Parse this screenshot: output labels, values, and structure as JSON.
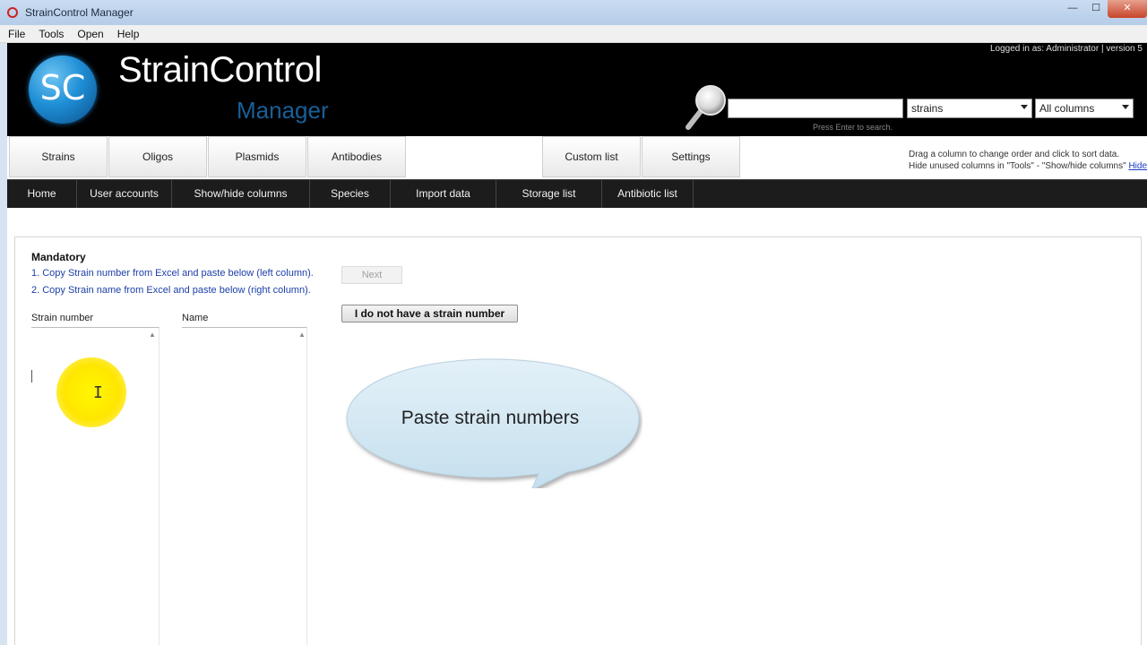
{
  "window": {
    "title": "StrainControl Manager",
    "minimize": "—",
    "maximize": "☐",
    "close": "✕"
  },
  "menu": [
    "File",
    "Tools",
    "Open",
    "Help"
  ],
  "header": {
    "logo_text": "SC",
    "app_name": "StrainControl",
    "app_subtitle": "Manager",
    "logged_in": "Logged in as: Administrator | version 5",
    "search_value": "",
    "search_hint": "Press Enter to search.",
    "search_type": "strains",
    "search_columns": "All columns"
  },
  "tabs": [
    "Strains",
    "Oligos",
    "Plasmids",
    "Antibodies",
    "Custom list",
    "Settings"
  ],
  "tab_help": {
    "line1": "Drag a column to change order and click to sort data.",
    "line2": "Hide unused columns in \"Tools\" - \"Show/hide columns\"",
    "hide_link": "Hide"
  },
  "subnav": [
    "Home",
    "User accounts",
    "Show/hide columns",
    "Species",
    "Import data",
    "Storage list",
    "Antibiotic list"
  ],
  "import": {
    "heading": "Mandatory",
    "step1": "1. Copy Strain number from Excel and paste below (left column).",
    "step2": "2. Copy Strain name from Excel and paste below (right column).",
    "next_label": "Next",
    "col_strain": "Strain number",
    "col_name": "Name",
    "no_strain_label": "I do not have a strain number"
  },
  "callout": {
    "text": "Paste strain numbers"
  },
  "colors": {
    "header_bg": "#000000",
    "subnav_bg": "#1c1c1c",
    "link_blue": "#1c3fa8",
    "highlight": "#ffe600",
    "bubble": "#cfe6f2"
  },
  "icons": {
    "app": "app-icon",
    "search": "magnifier-icon"
  }
}
